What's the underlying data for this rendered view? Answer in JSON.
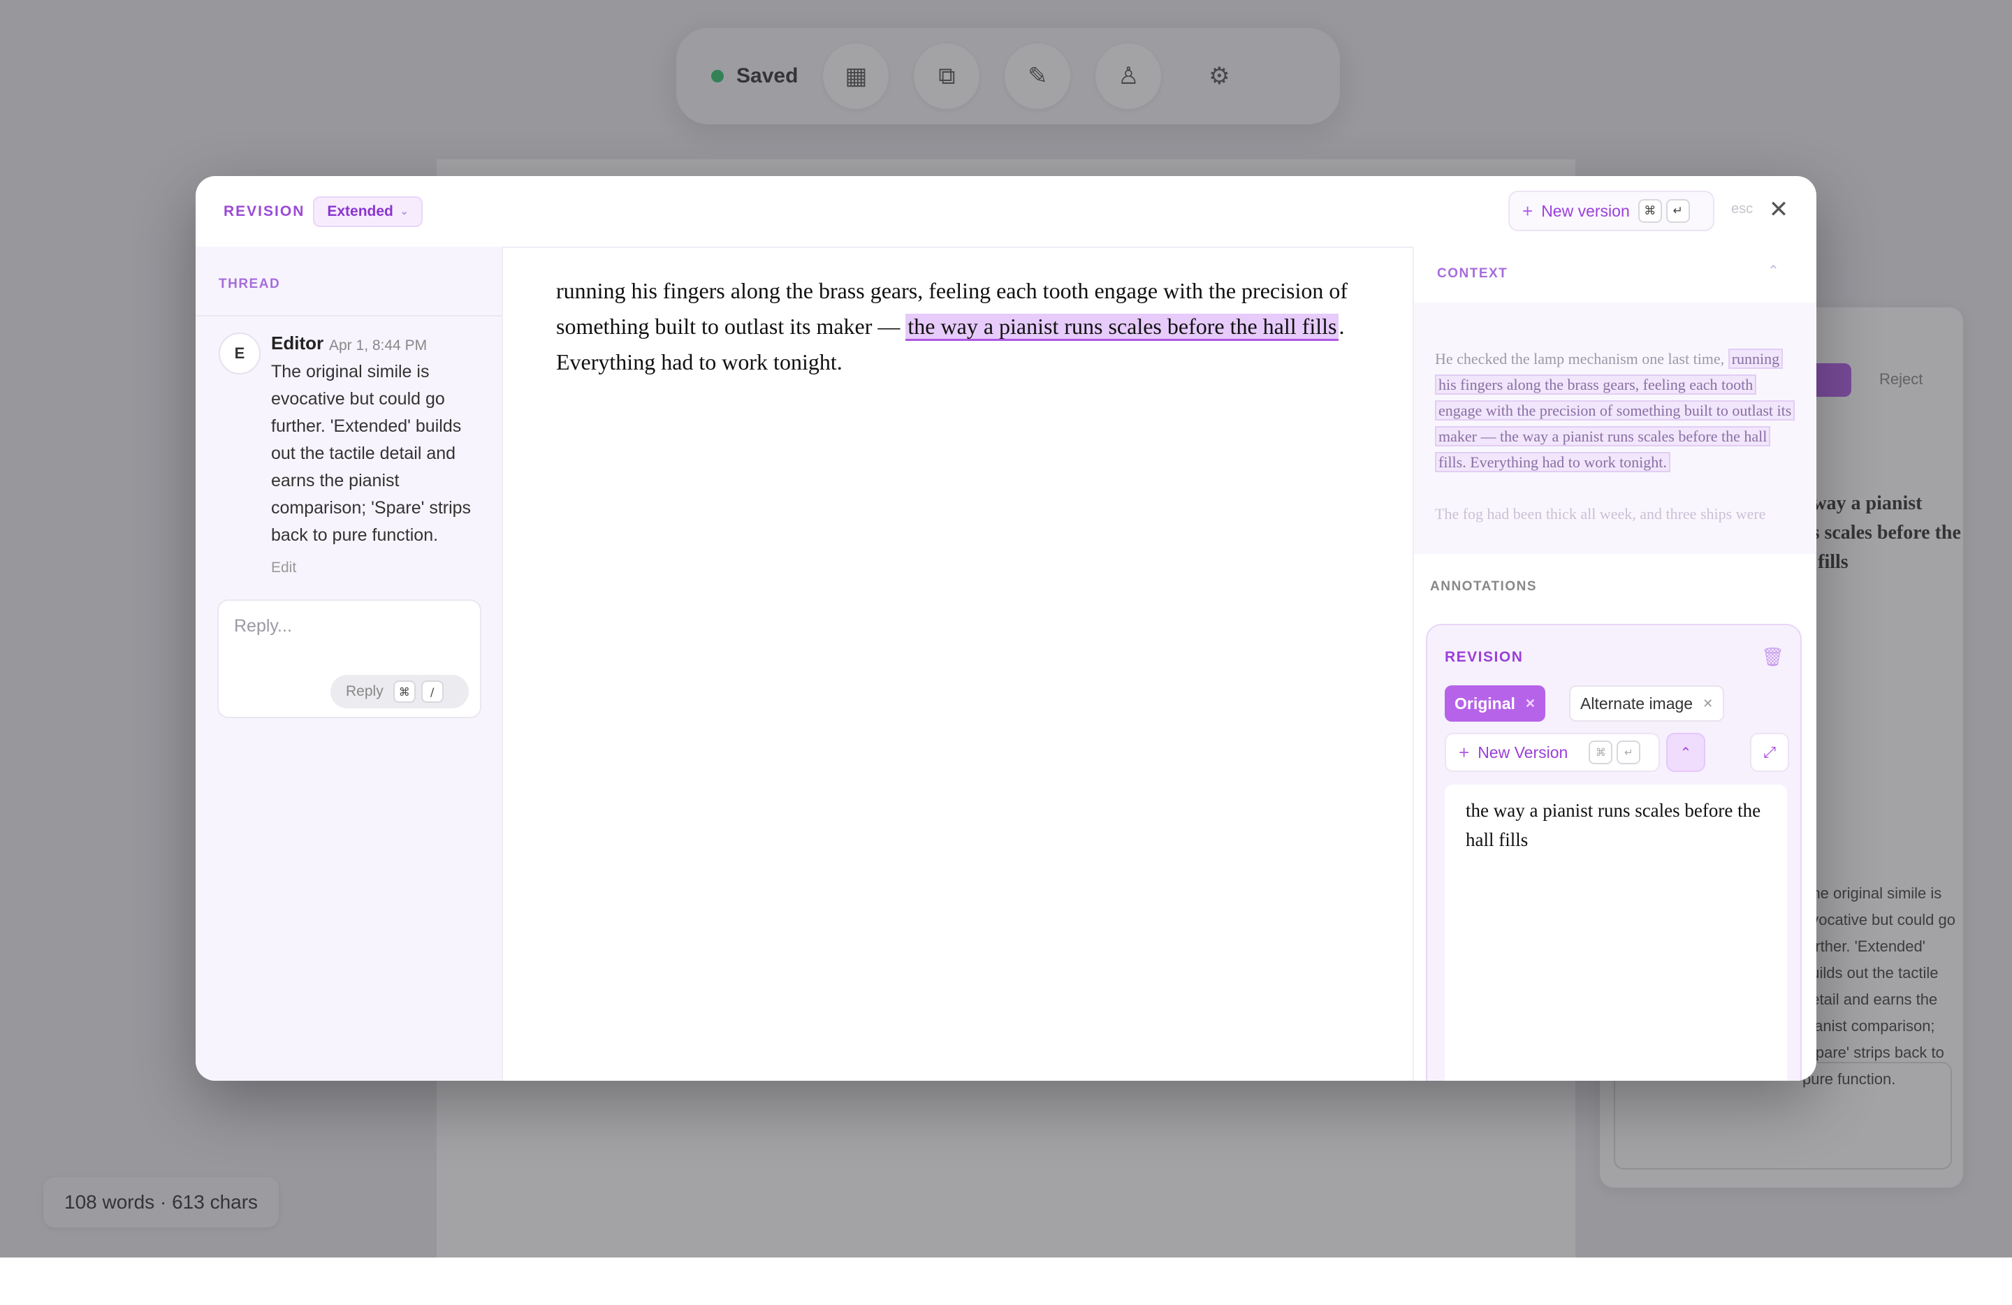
{
  "background": {
    "status": "Saved",
    "word_count": "108 words · 613 chars",
    "side_button_label": "Reject"
  },
  "modal": {
    "title": "REVISION",
    "variant": "Extended",
    "new_version_label": "New version",
    "shortcut_cmd": "⌘",
    "shortcut_enter": "↵",
    "esc_hint": "esc"
  },
  "thread": {
    "label": "THREAD",
    "comment": {
      "avatar_initial": "E",
      "author": "Editor",
      "date": "Apr 1, 8:44 PM",
      "body": "The original simile is evocative but could go further. 'Extended' builds out the tactile detail and earns the pianist comparison; 'Spare' strips back to pure function.",
      "edit_label": "Edit"
    },
    "reply": {
      "placeholder": "Reply...",
      "button_label": "Reply",
      "shortcut_cmd": "⌘",
      "shortcut_key": "/"
    }
  },
  "editor": {
    "text_before": "running his fingers along the brass gears, feeling each tooth engage with the precision of something built to outlast its maker — ",
    "highlighted": "the way a pianist runs scales before the hall fills",
    "text_after": ". Everything had to work tonight."
  },
  "context": {
    "label": "CONTEXT",
    "before": "He checked the lamp mechanism one last time,",
    "highlighted": "running his fingers along the brass gears, feeling each tooth engage with the precision of something built to outlast its maker — the way a pianist runs scales before the hall fills. Everything had to work tonight.",
    "after": "The fog had been thick all week, and three ships were"
  },
  "annotations": {
    "label": "ANNOTATIONS",
    "card": {
      "title": "REVISION",
      "chips": [
        {
          "label": "Original",
          "active": true
        },
        {
          "label": "Alternate image",
          "active": false
        }
      ],
      "new_version_label": "New Version",
      "shortcut_cmd": "⌘",
      "shortcut_enter": "↵",
      "text": "the way a pianist runs scales before the hall fills"
    }
  },
  "colors": {
    "accent": "#b663ea",
    "accent_text": "#9a3fd8",
    "highlight": "#e7cbfb",
    "saved_dot": "#2fc26a"
  }
}
